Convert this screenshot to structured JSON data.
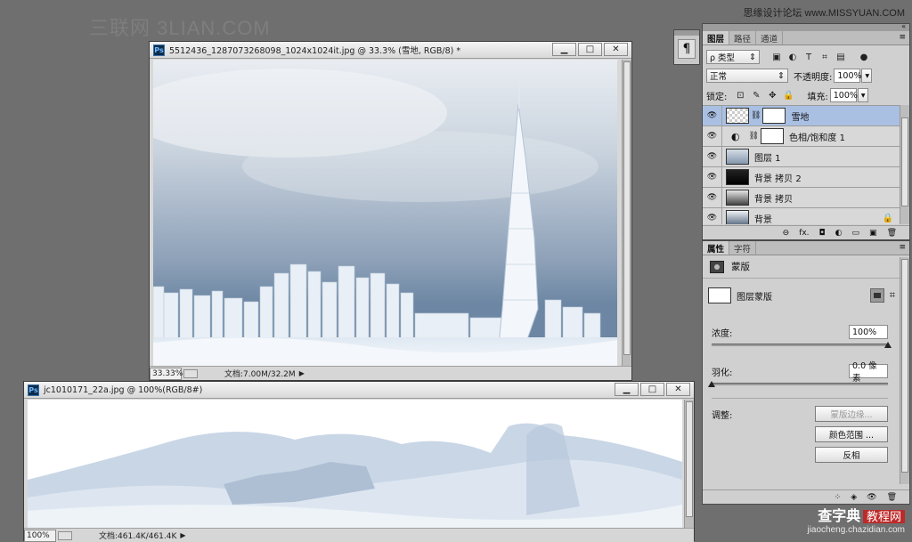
{
  "watermarks": {
    "left": "三联网 3LIAN.COM",
    "top_right": "思缘设计论坛 www.MISSYUAN.COM",
    "bottom_right_big": "查字典",
    "bottom_right_badge": "教程网",
    "bottom_right_url": "jiaocheng.chazidian.com"
  },
  "doc1": {
    "title": "5512436_1287073268098_1024x1024it.jpg @ 33.3% (雪地, RGB/8) *",
    "zoom": "33.33%",
    "doc_info": "文档:7.00M/32.2M"
  },
  "doc2": {
    "title": "jc1010171_22a.jpg @ 100%(RGB/8#)",
    "zoom": "100%",
    "doc_info": "文档:461.4K/461.4K"
  },
  "window_buttons": {
    "minimize": "▁",
    "maximize": "□",
    "close": "✕"
  },
  "paragraph_glyph": "¶",
  "layers_panel": {
    "tabs": [
      "图层",
      "路径",
      "通道"
    ],
    "kind_filter": "ρ 类型",
    "blend_mode": "正常",
    "opacity_label": "不透明度:",
    "opacity_value": "100%",
    "lock_label": "锁定:",
    "fill_label": "填充:",
    "fill_value": "100%",
    "layers": [
      {
        "name": "雪地",
        "selected": true
      },
      {
        "name": "色相/饱和度 1",
        "selected": false
      },
      {
        "name": "图层 1",
        "selected": false
      },
      {
        "name": "背景 拷贝 2",
        "selected": false
      },
      {
        "name": "背景 拷贝",
        "selected": false
      },
      {
        "name": "背景",
        "selected": false
      }
    ],
    "footer_icons": [
      "link-icon",
      "fx-icon",
      "add-mask-icon",
      "adjustment-icon",
      "group-icon",
      "new-layer-icon",
      "trash-icon"
    ],
    "footer_glyphs": [
      "⊖",
      "fx.",
      "◘",
      "◐",
      "▭",
      "▣",
      "🗑"
    ]
  },
  "properties_panel": {
    "tabs": [
      "属性",
      "字符"
    ],
    "heading": "蒙版",
    "mask_type": "图层蒙版",
    "density_label": "浓度:",
    "density_value": "100%",
    "density_fraction": 1.0,
    "feather_label": "羽化:",
    "feather_value": "0.0 像素",
    "feather_fraction": 0.0,
    "adjust_label": "调整:",
    "btn_mask_edge": "蒙版边缘...",
    "btn_color_range": "颜色范围 ...",
    "btn_invert": "反相"
  }
}
